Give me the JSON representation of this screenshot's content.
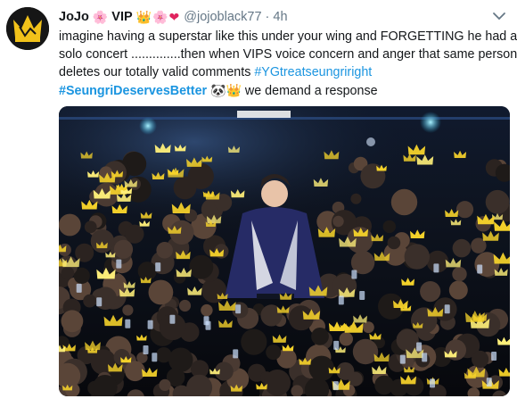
{
  "tweet": {
    "display_name": "JoJo",
    "name_suffix": "VIP",
    "handle": "@jojoblack77",
    "separator": "·",
    "time": "4h",
    "emojis": {
      "flower": "🌸",
      "crown": "👑",
      "heart": "❤",
      "panda": "🐼"
    },
    "text": {
      "line1": "imagine having a superstar like this under your wing and FORGETTING he had a",
      "line2": "solo concert ..............then when VIPS voice concern and anger that same person",
      "line3_text": "deletes our totally valid comments ",
      "line3_tag": "#YGtreatseungriright",
      "line4_tag": "#SeungriDeservesBetter",
      "line4_text": " we demand a response"
    },
    "menu_icon": "chevron-down-icon",
    "media_alt": "concert-photo"
  },
  "colors": {
    "link": "#1b95e0",
    "secondary": "#657786",
    "text": "#14171a"
  }
}
